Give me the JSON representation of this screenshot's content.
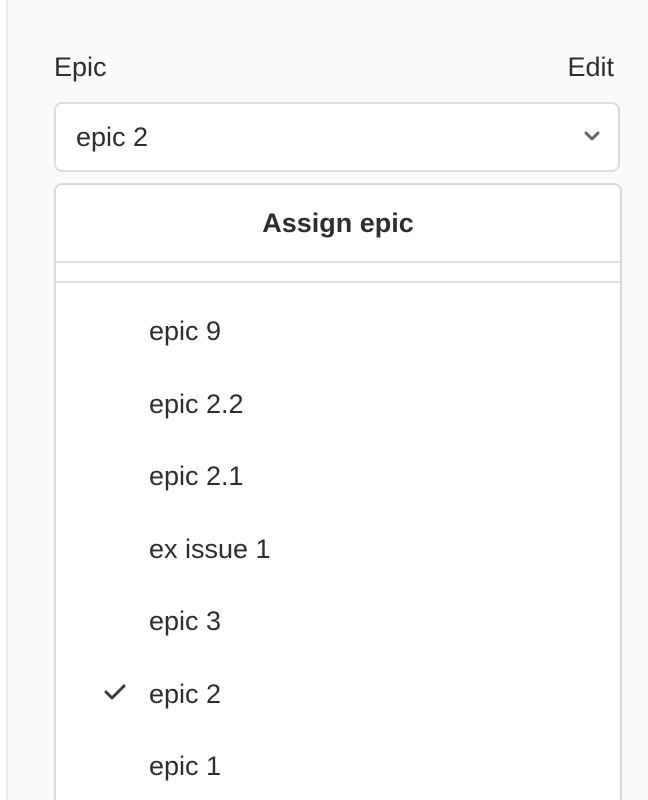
{
  "sidebar": {
    "epic_block": {
      "label": "Epic",
      "edit_label": "Edit",
      "selected_value": "epic 2",
      "toggle_icon": "chevron-down-icon"
    },
    "dropdown": {
      "title": "Assign epic",
      "items": [
        {
          "label": "epic 9",
          "selected": false
        },
        {
          "label": "epic 2.2",
          "selected": false
        },
        {
          "label": "epic 2.1",
          "selected": false
        },
        {
          "label": "ex issue 1",
          "selected": false
        },
        {
          "label": "epic 3",
          "selected": false
        },
        {
          "label": "epic 2",
          "selected": true
        },
        {
          "label": "epic 1",
          "selected": false
        }
      ],
      "selected_icon": "checkmark-icon"
    }
  },
  "colors": {
    "text": "#2e2e2e",
    "sidebar_bg": "#fafafa",
    "border": "#dcdcdc",
    "divider": "#dedede"
  }
}
